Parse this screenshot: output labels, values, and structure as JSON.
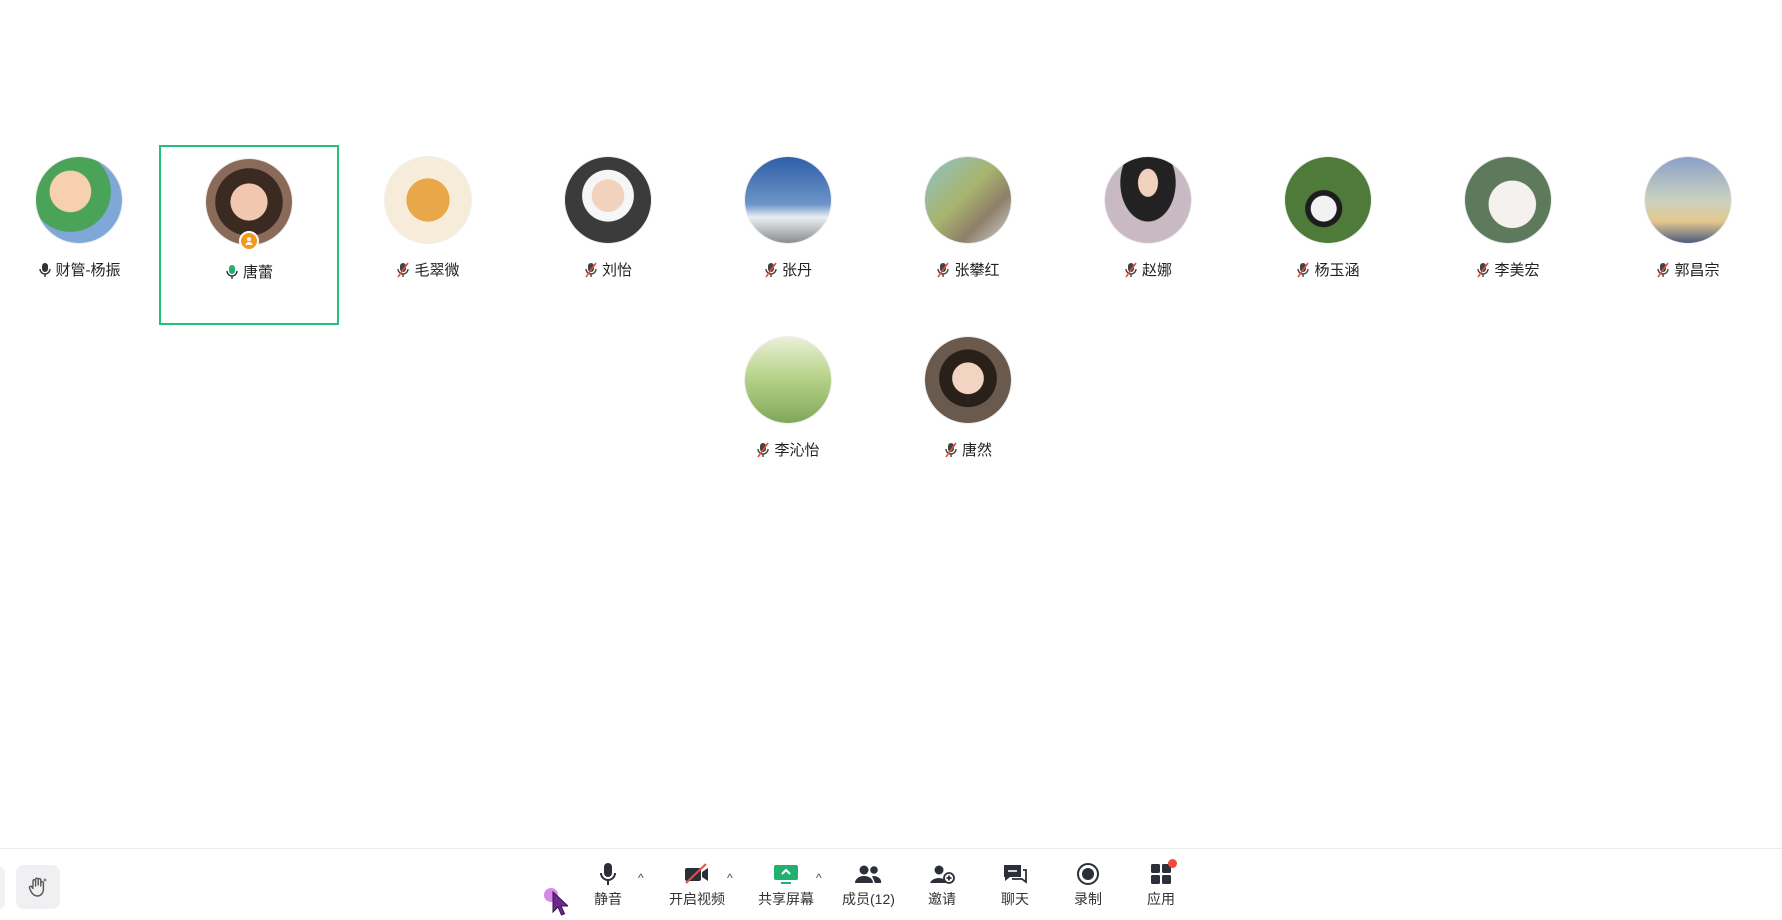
{
  "participants": [
    {
      "name": "财管-杨振",
      "mic": "on-dark",
      "avatar_color": "#7fa8d8",
      "active": false,
      "host": false
    },
    {
      "name": "唐蕾",
      "mic": "on-green",
      "avatar_color": "#7a4a3a",
      "active": true,
      "host": true
    },
    {
      "name": "毛翠微",
      "mic": "muted",
      "avatar_color": "#f3d9a3",
      "active": false,
      "host": false
    },
    {
      "name": "刘怡",
      "mic": "muted",
      "avatar_color": "#8d7e73",
      "active": false,
      "host": false
    },
    {
      "name": "张丹",
      "mic": "muted",
      "avatar_color": "#3f6fae",
      "active": false,
      "host": false
    },
    {
      "name": "张攀红",
      "mic": "muted",
      "avatar_color": "#7fa79a",
      "active": false,
      "host": false
    },
    {
      "name": "赵娜",
      "mic": "muted",
      "avatar_color": "#c8b9c2",
      "active": false,
      "host": false
    },
    {
      "name": "杨玉涵",
      "mic": "muted",
      "avatar_color": "#4e7a3a",
      "active": false,
      "host": false
    },
    {
      "name": "李美宏",
      "mic": "muted",
      "avatar_color": "#d9c3b0",
      "active": false,
      "host": false
    },
    {
      "name": "郭昌宗",
      "mic": "muted",
      "avatar_color": "#8aa0c8",
      "active": false,
      "host": false
    },
    {
      "name": "李沁怡",
      "mic": "muted",
      "avatar_color": "#9dc07a",
      "active": false,
      "host": false
    },
    {
      "name": "唐然",
      "mic": "muted",
      "avatar_color": "#5a4a3e",
      "active": false,
      "host": false
    }
  ],
  "toolbar": {
    "mute_label": "静音",
    "video_label": "开启视频",
    "share_label": "共享屏幕",
    "members_label": "成员(12)",
    "invite_label": "邀请",
    "chat_label": "聊天",
    "record_label": "录制",
    "apps_label": "应用",
    "caret": "^"
  },
  "colors": {
    "active_border": "#22c07a",
    "share_icon": "#22b070",
    "muted_slash": "#e0533d",
    "notify_dot": "#f04a3a"
  }
}
